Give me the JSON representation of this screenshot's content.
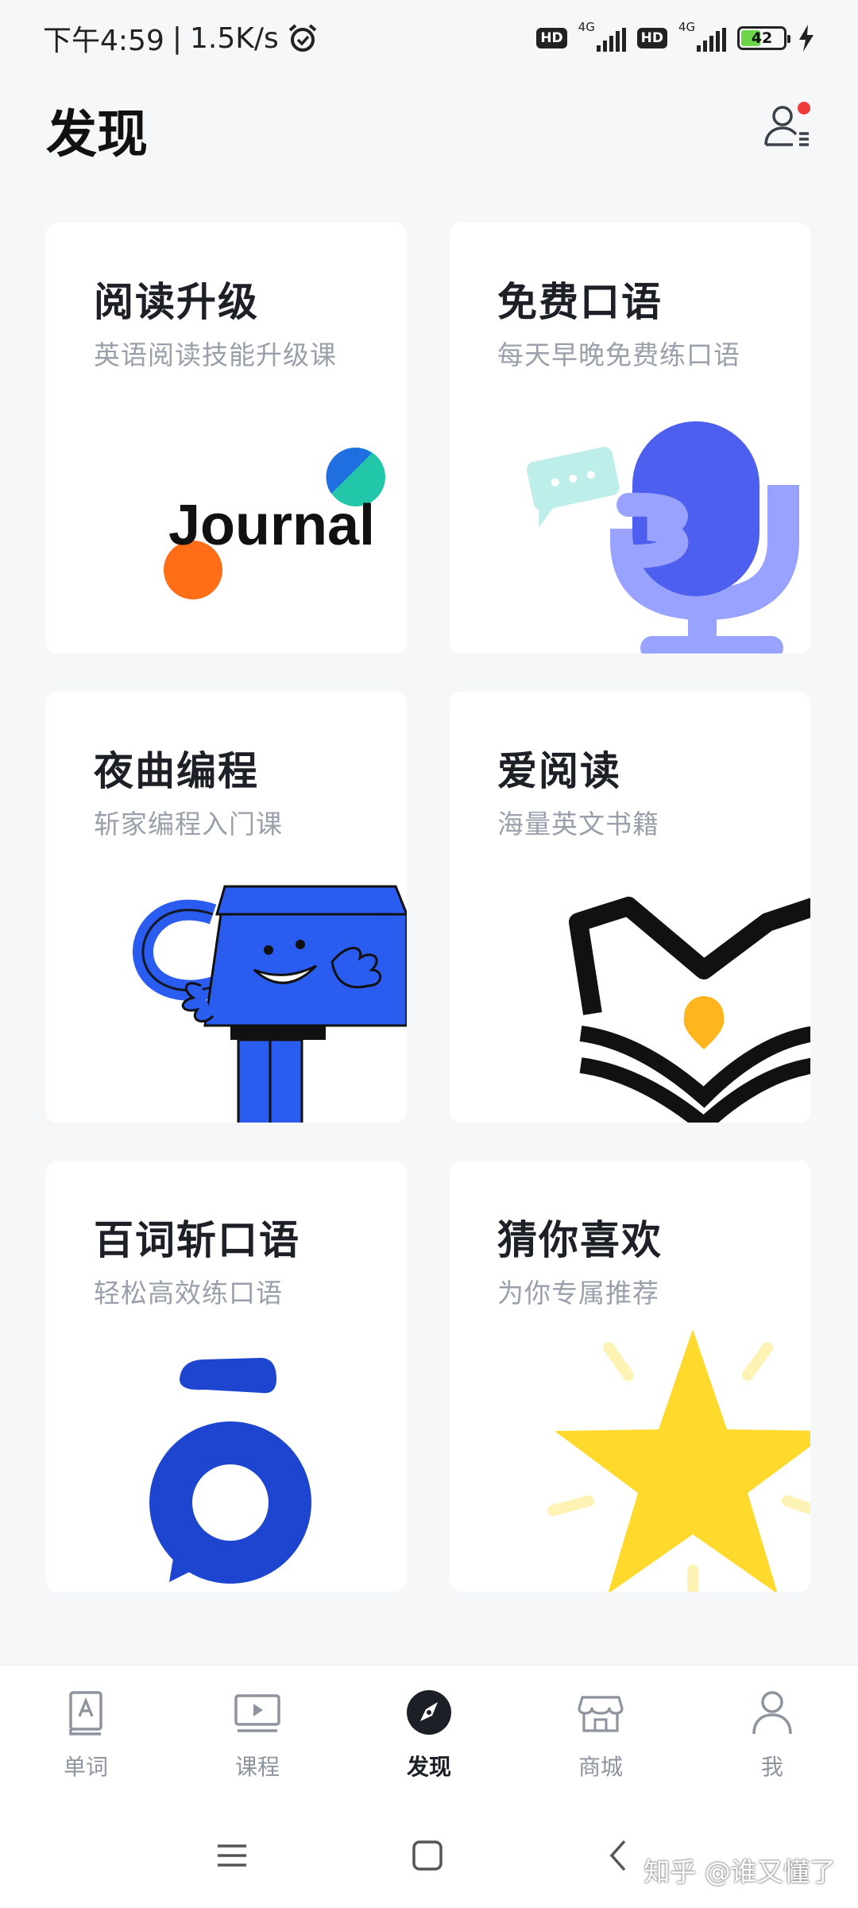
{
  "status_bar": {
    "time": "下午4:59",
    "separator": "|",
    "net_speed": "1.5K/s",
    "alarm_icon": "alarm-icon",
    "sim1_hd": "HD",
    "sim1_net": "4G",
    "sim2_hd": "HD",
    "sim2_net": "4G",
    "battery": "42",
    "charging_icon": "bolt-icon"
  },
  "header": {
    "title": "发现",
    "profile_icon": "user-notification-icon",
    "notification_color": "#ef3b3b"
  },
  "cards": [
    {
      "title": "阅读升级",
      "subtitle": "英语阅读技能升级课",
      "art_text": "Journal"
    },
    {
      "title": "免费口语",
      "subtitle": "每天早晚免费练口语"
    },
    {
      "title": "夜曲编程",
      "subtitle": "斩家编程入门课"
    },
    {
      "title": "爱阅读",
      "subtitle": "海量英文书籍"
    },
    {
      "title": "百词斩口语",
      "subtitle": "轻松高效练口语"
    },
    {
      "title": "猜你喜欢",
      "subtitle": "为你专属推荐"
    }
  ],
  "bottom_nav": {
    "items": [
      {
        "label": "单词",
        "icon": "book-a-icon",
        "active": false
      },
      {
        "label": "课程",
        "icon": "video-lesson-icon",
        "active": false
      },
      {
        "label": "发现",
        "icon": "compass-icon",
        "active": true
      },
      {
        "label": "商城",
        "icon": "shop-icon",
        "active": false
      },
      {
        "label": "我",
        "icon": "person-icon",
        "active": false
      }
    ]
  },
  "system_nav": {
    "menu_icon": "menu-icon",
    "home_icon": "home-square-icon",
    "back_icon": "back-chevron-icon"
  },
  "watermark": "知乎 @谁又懂了",
  "colors": {
    "accent": "#3a63f3",
    "active_nav": "#1c1f26",
    "inactive_nav": "#8e949e"
  }
}
